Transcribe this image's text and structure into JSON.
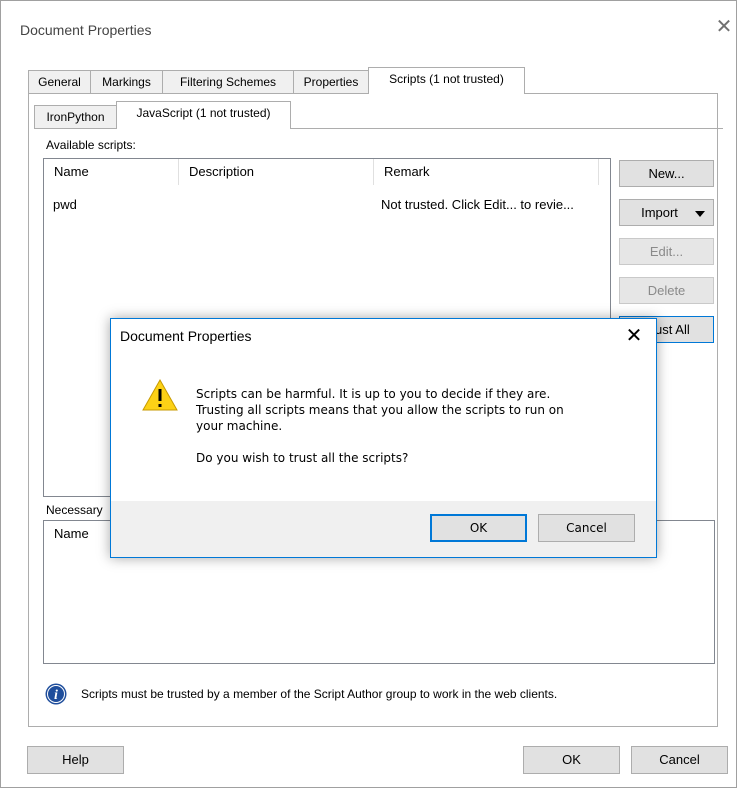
{
  "window": {
    "title": "Document Properties",
    "close_glyph": "✕"
  },
  "tabs": [
    "General",
    "Markings",
    "Filtering Schemes",
    "Properties",
    "Scripts (1 not trusted)"
  ],
  "subtabs": [
    "IronPython",
    "JavaScript (1 not trusted)"
  ],
  "available_scripts": {
    "label": "Available scripts:",
    "columns": [
      "Name",
      "Description",
      "Remark"
    ],
    "rows": [
      {
        "name": "pwd",
        "description": "",
        "remark": "Not trusted. Click Edit... to revie..."
      }
    ]
  },
  "side_buttons": {
    "new": "New...",
    "import": "Import",
    "edit": "Edit...",
    "delete": "Delete",
    "trust_all": "Trust All"
  },
  "necessary": {
    "label": "Necessary",
    "columns": [
      "Name"
    ]
  },
  "info_text": "Scripts must be trusted by a member of the Script Author group to work in the web clients.",
  "footer": {
    "help": "Help",
    "ok": "OK",
    "cancel": "Cancel"
  },
  "dialog": {
    "title": "Document Properties",
    "lines": [
      "Scripts can be harmful. It is up to you to decide if they are.",
      "Trusting all scripts means that you allow the scripts to run on",
      "your machine."
    ],
    "question": "Do you wish to trust all the scripts?",
    "ok": "OK",
    "cancel": "Cancel"
  },
  "colors": {
    "accent": "#0078d7",
    "warning": "#fcd116",
    "info": "#1f4e9c"
  }
}
